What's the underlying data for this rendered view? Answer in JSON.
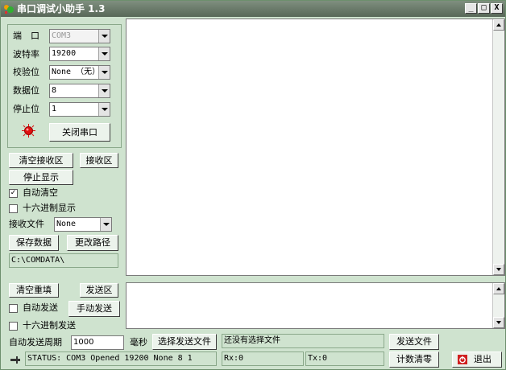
{
  "window": {
    "title": "串口调试小助手 1.3",
    "min_glyph": "_",
    "max_glyph": "□",
    "close_glyph": "X"
  },
  "settings": {
    "port_label": "端　口",
    "port_value": "COM3",
    "baud_label": "波特率",
    "baud_value": "19200",
    "parity_label": "校验位",
    "parity_value": "None （无）",
    "databits_label": "数据位",
    "databits_value": "8",
    "stopbits_label": "停止位",
    "stopbits_value": "1",
    "close_port_label": "关闭串口"
  },
  "receive": {
    "clear_label": "清空接收区",
    "area_label": "接收区",
    "stop_display_label": "停止显示",
    "auto_clear_label": "自动清空",
    "auto_clear_checked": "✓",
    "hex_display_label": "十六进制显示",
    "file_label": "接收文件",
    "file_value": "None",
    "save_data_label": "保存数据",
    "change_path_label": "更改路径",
    "path_value": "C:\\COMDATA\\"
  },
  "send": {
    "clear_label": "清空重填",
    "area_label": "发送区",
    "auto_send_label": "自动发送",
    "manual_send_label": "手动发送",
    "hex_send_label": "十六进制发送",
    "period_label": "自动发送周期",
    "period_value": "1000",
    "ms_label": "毫秒",
    "choose_file_label": "选择发送文件",
    "file_status": "还没有选择文件",
    "send_file_label": "发送文件"
  },
  "status": {
    "text": "STATUS: COM3 Opened 19200 None  8 1",
    "rx": "Rx:0",
    "tx": "Tx:0",
    "reset_count_label": "计数清零",
    "exit_label": "退出"
  },
  "colors": {
    "background": "#cfe3cf",
    "title_bar": "#5f6f5f",
    "led": "#e01010"
  }
}
